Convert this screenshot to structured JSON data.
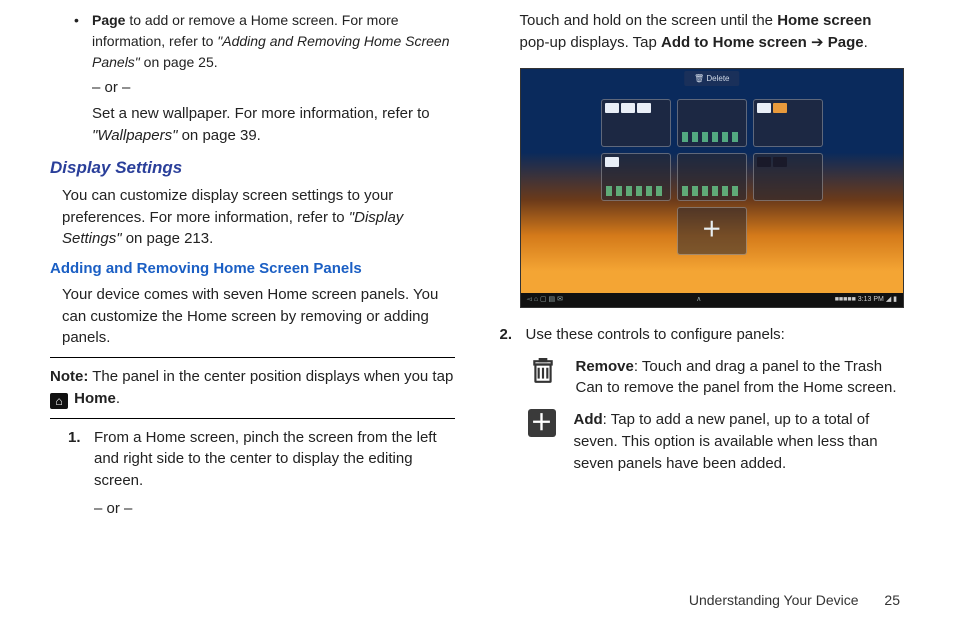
{
  "left": {
    "bullet_page_bold": "Page",
    "bullet_page_rest": " to add or remove a Home screen. For more information, refer to ",
    "bullet_page_ref": "\"Adding and Removing Home Screen Panels\"",
    "bullet_page_tail": " on page 25.",
    "or": "– or –",
    "wallpaper_line": "Set a new wallpaper. For more information, refer to ",
    "wallpaper_ref": "\"Wallpapers\"",
    "wallpaper_tail": "  on page 39.",
    "display_settings_h": "Display Settings",
    "display_settings_p1": "You can customize display screen settings to your preferences. For more information, refer to ",
    "display_settings_ref": "\"Display Settings\"",
    "display_settings_tail": "  on page 213.",
    "adding_h": "Adding and Removing Home Screen Panels",
    "adding_p": "Your device comes with seven Home screen panels. You can customize the Home screen by removing or adding panels.",
    "note_label": "Note:",
    "note_text": " The panel in the center position displays when you tap ",
    "home_label": "Home",
    "step1_num": "1.",
    "step1_text": "From a Home screen, pinch the screen from the left and right side to the center to display the editing screen.",
    "step1_or": "– or –"
  },
  "right": {
    "touch_hold_1": "Touch and hold on the screen until the ",
    "touch_hold_b1": "Home screen",
    "touch_hold_2": " pop-up displays. Tap ",
    "touch_hold_b2": "Add to Home screen",
    "arrow": " ➔ ",
    "touch_hold_b3": "Page",
    "touch_hold_tail": ".",
    "shot_delete": "Delete",
    "shot_time": "3:13 PM",
    "step2_num": "2.",
    "step2_text": "Use these controls to configure panels:",
    "remove_b": "Remove",
    "remove_text": ": Touch and drag a panel to the Trash Can to remove the panel from the Home screen.",
    "add_b": "Add",
    "add_text": ": Tap to add a new panel, up to a total of seven. This option is available when less than seven panels have been added."
  },
  "footer": {
    "section": "Understanding Your Device",
    "page": "25"
  }
}
